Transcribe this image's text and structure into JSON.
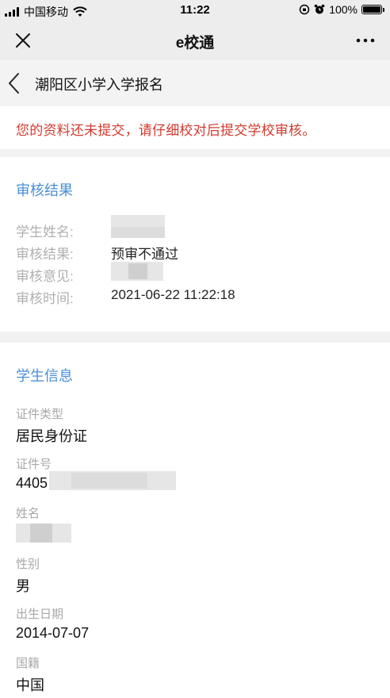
{
  "status_bar": {
    "carrier": "中国移动",
    "time": "11:22",
    "battery": "100%"
  },
  "nav": {
    "title": "e校通"
  },
  "page": {
    "title": "潮阳区小学入学报名"
  },
  "notice": "您的资料还未提交，请仔细校对后提交学校审核。",
  "review": {
    "title": "审核结果",
    "rows": [
      {
        "label": "学生姓名:",
        "value": ""
      },
      {
        "label": "审核结果:",
        "value": "预审不通过"
      },
      {
        "label": "审核意见:",
        "value": ""
      },
      {
        "label": "审核时间:",
        "value": "2021-06-22 11:22:18"
      }
    ]
  },
  "student": {
    "title": "学生信息",
    "fields": [
      {
        "label": "证件类型",
        "value": "居民身份证"
      },
      {
        "label": "证件号",
        "value": "4405"
      },
      {
        "label": "姓名",
        "value": ""
      },
      {
        "label": "性别",
        "value": "男"
      },
      {
        "label": "出生日期",
        "value": "2014-07-07"
      },
      {
        "label": "国籍",
        "value": "中国"
      }
    ]
  },
  "icons": {
    "close": "close-icon",
    "more": "more-icon",
    "back": "back-chevron-icon",
    "wifi": "wifi-icon",
    "signal": "signal-icon",
    "alarm": "alarm-icon",
    "lock": "orientation-lock-icon",
    "battery": "battery-icon"
  },
  "colors": {
    "notice": "#d23b2e",
    "accent": "#4a8fd6"
  }
}
